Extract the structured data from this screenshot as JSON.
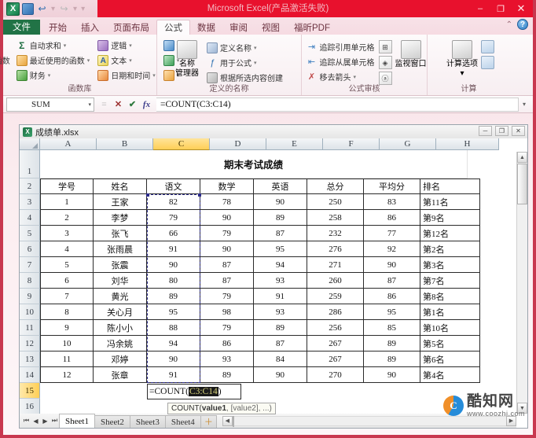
{
  "window": {
    "title": "Microsoft Excel(产品激活失败)",
    "minimize": "–",
    "maximize": "❐",
    "close": "✕"
  },
  "quick_access": {
    "app_logo": "X",
    "save": "save-icon",
    "undo": "↩",
    "redo": "↪",
    "customize": "▾"
  },
  "tabs": [
    {
      "label": "文件",
      "active": false,
      "file": true
    },
    {
      "label": "开始",
      "active": false
    },
    {
      "label": "插入",
      "active": false
    },
    {
      "label": "页面布局",
      "active": false
    },
    {
      "label": "公式",
      "active": true
    },
    {
      "label": "数据",
      "active": false
    },
    {
      "label": "审阅",
      "active": false
    },
    {
      "label": "视图",
      "active": false
    },
    {
      "label": "福昕PDF",
      "active": false
    }
  ],
  "tabbar_right": {
    "minimize_ribbon": "⌃",
    "help": "?"
  },
  "ribbon": {
    "groups": [
      {
        "label": "函数库",
        "big_button": {
          "label": "插入函数",
          "glyph": "fx"
        },
        "col1": [
          {
            "label": "自动求和",
            "icon": "sum-icon",
            "glyph": "Σ",
            "arrow": "▾"
          },
          {
            "label": "最近使用的函数",
            "icon": "recent-functions-icon",
            "arrow": "▾"
          },
          {
            "label": "财务",
            "icon": "financial-icon",
            "arrow": "▾"
          }
        ],
        "col2": [
          {
            "label": "逻辑",
            "icon": "logical-icon",
            "arrow": "▾"
          },
          {
            "label": "文本",
            "icon": "text-icon",
            "glyph": "A",
            "arrow": "▾"
          },
          {
            "label": "日期和时间",
            "icon": "date-time-icon",
            "arrow": "▾"
          }
        ],
        "col3": [
          {
            "label": "",
            "icon": "lookup-reference-icon",
            "arrow": "▾"
          },
          {
            "label": "",
            "icon": "math-trig-icon",
            "arrow": "▾"
          },
          {
            "label": "",
            "icon": "more-functions-icon",
            "arrow": "▾"
          }
        ]
      },
      {
        "label": "定义的名称",
        "name_manager": {
          "label1": "名称",
          "label2": "管理器",
          "icon": "name-manager-icon"
        },
        "items": [
          {
            "label": "定义名称",
            "icon": "define-name-icon",
            "arrow": "▾"
          },
          {
            "label": "用于公式",
            "icon": "use-in-formula-icon",
            "arrow": "▾"
          },
          {
            "label": "根据所选内容创建",
            "icon": "create-from-selection-icon"
          }
        ]
      },
      {
        "label": "公式审核",
        "items": [
          {
            "label": "追踪引用单元格",
            "icon": "trace-precedents-icon"
          },
          {
            "label": "追踪从属单元格",
            "icon": "trace-dependents-icon"
          },
          {
            "label": "移去箭头",
            "icon": "remove-arrows-icon",
            "arrow": "▾"
          }
        ],
        "side_items": [
          {
            "label": "",
            "icon": "show-formulas-icon"
          },
          {
            "label": "",
            "icon": "error-checking-icon",
            "arrow": "▾"
          },
          {
            "label": "",
            "icon": "evaluate-formula-icon"
          }
        ],
        "watch_window": {
          "label": "监视窗口",
          "icon": "watch-window-icon"
        }
      },
      {
        "label": "计算",
        "calc_options": {
          "label": "计算选项",
          "icon": "calculation-options-icon",
          "arrow": "▾"
        },
        "side_items": [
          {
            "label": "",
            "icon": "calculate-now-icon"
          },
          {
            "label": "",
            "icon": "calculate-sheet-icon"
          }
        ]
      }
    ]
  },
  "formula_bar": {
    "name_box_value": "SUM",
    "name_box_arrow": "▾",
    "cancel": "✕",
    "enter": "✔",
    "insert_function": "fx",
    "formula": "=COUNT(C3:C14)",
    "expand": "▾",
    "dim_dot": "="
  },
  "document": {
    "title": "成绩单.xlsx",
    "window_buttons": {
      "minimize": "─",
      "restore": "❐",
      "close": "✕"
    }
  },
  "grid": {
    "column_headers": [
      "A",
      "B",
      "C",
      "D",
      "E",
      "F",
      "G",
      "H"
    ],
    "selected_column": "C",
    "row_headers": [
      "1",
      "2",
      "3",
      "4",
      "5",
      "6",
      "7",
      "8",
      "9",
      "10",
      "11",
      "12",
      "13",
      "14",
      "15",
      "16"
    ],
    "selected_row": "15",
    "sheet_title": "期末考试成绩",
    "table_headers": [
      "学号",
      "姓名",
      "语文",
      "数学",
      "英语",
      "总分",
      "平均分",
      "排名"
    ],
    "rows": [
      [
        "1",
        "王家",
        "82",
        "78",
        "90",
        "250",
        "83",
        "第11名"
      ],
      [
        "2",
        "李梦",
        "79",
        "90",
        "89",
        "258",
        "86",
        "第9名"
      ],
      [
        "3",
        "张飞",
        "66",
        "79",
        "87",
        "232",
        "77",
        "第12名"
      ],
      [
        "4",
        "张雨晨",
        "91",
        "90",
        "95",
        "276",
        "92",
        "第2名"
      ],
      [
        "5",
        "张震",
        "90",
        "87",
        "94",
        "271",
        "90",
        "第3名"
      ],
      [
        "6",
        "刘华",
        "80",
        "87",
        "93",
        "260",
        "87",
        "第7名"
      ],
      [
        "7",
        "黄光",
        "89",
        "79",
        "91",
        "259",
        "86",
        "第8名"
      ],
      [
        "8",
        "关心月",
        "95",
        "98",
        "93",
        "286",
        "95",
        "第1名"
      ],
      [
        "9",
        "陈小小",
        "88",
        "79",
        "89",
        "256",
        "85",
        "第10名"
      ],
      [
        "10",
        "冯余姚",
        "94",
        "86",
        "87",
        "267",
        "89",
        "第5名"
      ],
      [
        "11",
        "邓婷",
        "90",
        "93",
        "84",
        "267",
        "89",
        "第6名"
      ],
      [
        "12",
        "张章",
        "91",
        "89",
        "90",
        "270",
        "90",
        "第4名"
      ]
    ],
    "editing": {
      "prefix": "=COUNT(",
      "range": "C3:C14",
      "suffix": ")"
    },
    "tooltip": {
      "name": "COUNT(",
      "arg1": "value1",
      "rest": ", [value2], ...)"
    }
  },
  "sheet_tabs": {
    "nav": {
      "first": "⏮",
      "prev": "◀",
      "next": "▶",
      "last": "⏭"
    },
    "tabs": [
      "Sheet1",
      "Sheet2",
      "Sheet3",
      "Sheet4"
    ],
    "active": "Sheet1",
    "new_sheet": "＋"
  },
  "scroll": {
    "up": "▲",
    "down": "▼",
    "left": "◀",
    "right": "▶"
  },
  "watermark": {
    "logo_letter": "C",
    "name": "酷知网",
    "url": "www.coozhi.com"
  }
}
